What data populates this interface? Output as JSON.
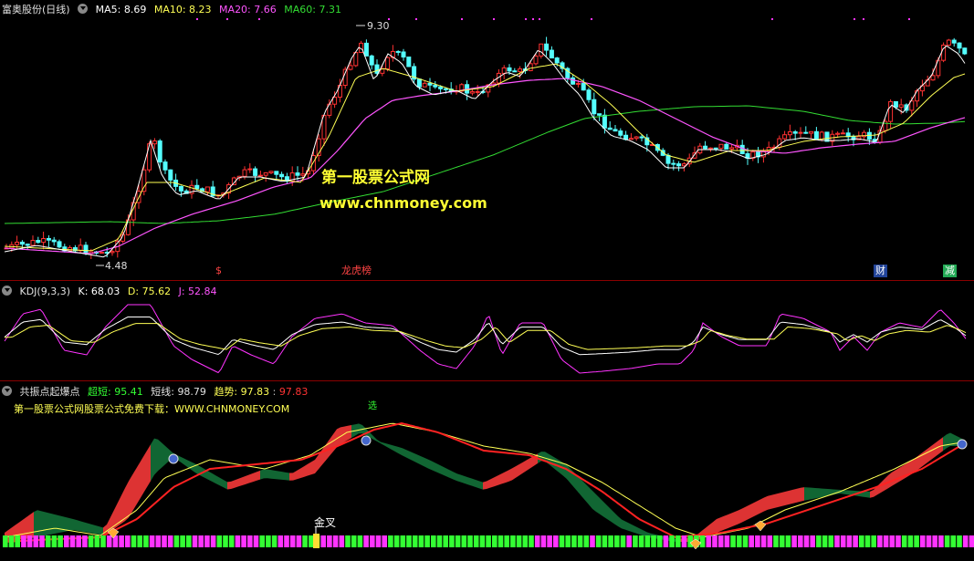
{
  "main": {
    "title": "富奥股份(日线)",
    "ma": [
      {
        "label": "MA5:",
        "value": "8.69",
        "color": "#ffffff"
      },
      {
        "label": "MA10:",
        "value": "8.23",
        "color": "#ffff55"
      },
      {
        "label": "MA20:",
        "value": "7.66",
        "color": "#ff55ff"
      },
      {
        "label": "MA60:",
        "value": "7.31",
        "color": "#33dd33"
      }
    ],
    "high_label": "9.30",
    "low_label": "4.48",
    "watermark_1": "第一股票公式网",
    "watermark_2": "www.chnmoney.com",
    "tags": [
      {
        "text": "$",
        "color": "#ff4444",
        "bg": "transparent"
      },
      {
        "text": "龙虎榜",
        "color": "#ff4444",
        "bg": "transparent"
      },
      {
        "text": "财",
        "color": "#ffffff",
        "bg": "#224499"
      },
      {
        "text": "减",
        "color": "#ffffff",
        "bg": "#22aa55"
      }
    ]
  },
  "kdj": {
    "title": "KDJ(9,3,3)",
    "k": "K: 68.03",
    "d": "D: 75.62",
    "j": "J: 52.84"
  },
  "indicator": {
    "title": "共振点起爆点",
    "chao_label": "超短:",
    "chao_value": "95.41",
    "duan_label": "短线:",
    "duan_value": "98.79",
    "qushi_label": "趋势:",
    "qushi_value_1": "97.83",
    "qushi_value_2": "97.83",
    "promo": "第一股票公式网股票公式免费下载：WWW.CHNMONEY.COM",
    "xuan": "选",
    "jincha": "金叉"
  },
  "colors": {
    "up": "#ff3232",
    "down": "#54ffff",
    "ma5": "#ffffff",
    "ma10": "#ffff55",
    "ma20": "#ff55ff",
    "ma60": "#33dd33",
    "band_up": "#dd3333",
    "band_down": "#116633"
  },
  "icons": {
    "collapse": "circle-chevron-icon",
    "diamond": "diamond-icon",
    "signal": "cup-icon"
  }
}
